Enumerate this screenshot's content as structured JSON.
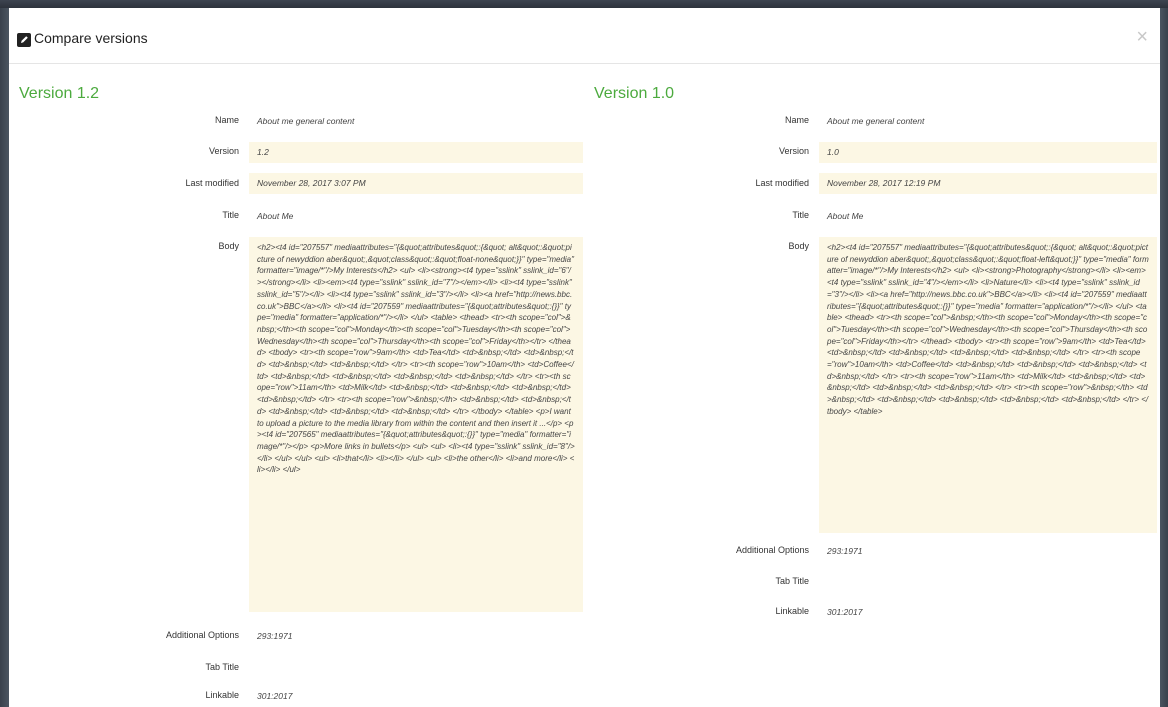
{
  "modal": {
    "title": "Compare versions",
    "close_symbol": "×",
    "icon": "edit-square-icon"
  },
  "labels": {
    "name": "Name",
    "version": "Version",
    "last_modified": "Last modified",
    "title": "Title",
    "body": "Body",
    "additional_options": "Additional Options",
    "tab_title": "Tab Title",
    "linkable": "Linkable"
  },
  "left": {
    "heading": "Version 1.2",
    "name": "About me general content",
    "version": "1.2",
    "last_modified": "November 28, 2017 3:07 PM",
    "title": "About Me",
    "body": "<h2><t4 id=\"207557\" mediaattributes=\"{&quot;attributes&quot;:{&quot; alt&quot;:&quot;picture of newyddion aber&quot;,&quot;class&quot;:&quot;float-none&quot;}}\" type=\"media\" formatter=\"image/*\"/>My Interests</h2> <ul> <li><strong><t4 type=\"sslink\" sslink_id=\"6\"/></strong></li> <li><em><t4 type=\"sslink\" sslink_id=\"7\"/></em></li> <li><t4 type=\"sslink\" sslink_id=\"5\"/></li> <li><t4 type=\"sslink\" sslink_id=\"3\"/></li> <li><a href=\"http://news.bbc.co.uk\">BBC</a></li> <li><t4 id=\"207559\" mediaattributes=\"{&quot;attributes&quot;:{}}\" type=\"media\" formatter=\"application/*\"/></li> </ul> <table> <thead> <tr><th scope=\"col\">&nbsp;</th><th scope=\"col\">Monday</th><th scope=\"col\">Tuesday</th><th scope=\"col\">Wednesday</th><th scope=\"col\">Thursday</th><th scope=\"col\">Friday</th></tr> </thead> <tbody> <tr><th scope=\"row\">9am</th> <td>Tea</td> <td>&nbsp;</td> <td>&nbsp;</td> <td>&nbsp;</td> <td>&nbsp;</td> </tr> <tr><th scope=\"row\">10am</th> <td>Coffee</td> <td>&nbsp;</td> <td>&nbsp;</td> <td>&nbsp;</td> <td>&nbsp;</td> </tr> <tr><th scope=\"row\">11am</th> <td>Milk</td> <td>&nbsp;</td> <td>&nbsp;</td> <td>&nbsp;</td> <td>&nbsp;</td> </tr> <tr><th scope=\"row\">&nbsp;</th> <td>&nbsp;</td> <td>&nbsp;</td> <td>&nbsp;</td> <td>&nbsp;</td> <td>&nbsp;</td> </tr> </tbody> </table> <p>I want to upload a picture to the media library from within the content and then insert it ...</p> <p><t4 id=\"207565\" mediaattributes=\"{&quot;attributes&quot;:{}}\" type=\"media\" formatter=\"image/*\"/></p> <p>More links in bullets</p> <ul> <ul> <li><t4 type=\"sslink\" sslink_id=\"8\"/></li> </ul> </ul> <ul> <li>that</li> <li></li> </ul> <ul> <li>the other</li> <li>and more</li> <li></li> </ul>",
    "additional_options": "293:1971",
    "tab_title": "",
    "linkable": "301:2017"
  },
  "right": {
    "heading": "Version 1.0",
    "name": "About me general content",
    "version": "1.0",
    "last_modified": "November 28, 2017 12:19 PM",
    "title": "About Me",
    "body": "<h2><t4 id=\"207557\" mediaattributes=\"{&quot;attributes&quot;:{&quot; alt&quot;:&quot;picture of newyddion aber&quot;,&quot;class&quot;:&quot;float-left&quot;}}\" type=\"media\" formatter=\"image/*\"/>My Interests</h2> <ul> <li><strong>Photography</strong></li> <li><em><t4 type=\"sslink\" sslink_id=\"4\"/></em></li> <li>Nature</li> <li><t4 type=\"sslink\" sslink_id=\"3\"/></li> <li><a href=\"http://news.bbc.co.uk\">BBC</a></li> <li><t4 id=\"207559\" mediaattributes=\"{&quot;attributes&quot;:{}}\" type=\"media\" formatter=\"application/*\"/></li> </ul> <table> <thead> <tr><th scope=\"col\">&nbsp;</th><th scope=\"col\">Monday</th><th scope=\"col\">Tuesday</th><th scope=\"col\">Wednesday</th><th scope=\"col\">Thursday</th><th scope=\"col\">Friday</th></tr> </thead> <tbody> <tr><th scope=\"row\">9am</th> <td>Tea</td> <td>&nbsp;</td> <td>&nbsp;</td> <td>&nbsp;</td> <td>&nbsp;</td> </tr> <tr><th scope=\"row\">10am</th> <td>Coffee</td> <td>&nbsp;</td> <td>&nbsp;</td> <td>&nbsp;</td> <td>&nbsp;</td> </tr> <tr><th scope=\"row\">11am</th> <td>Milk</td> <td>&nbsp;</td> <td>&nbsp;</td> <td>&nbsp;</td> <td>&nbsp;</td> </tr> <tr><th scope=\"row\">&nbsp;</th> <td>&nbsp;</td> <td>&nbsp;</td> <td>&nbsp;</td> <td>&nbsp;</td> <td>&nbsp;</td> </tr> </tbody> </table>",
    "additional_options": "293:1971",
    "tab_title": "",
    "linkable": "301:2017"
  },
  "colors": {
    "heading_green": "#4caa3e",
    "shaded_row": "#fcf7e4",
    "backdrop": "#39414c"
  }
}
